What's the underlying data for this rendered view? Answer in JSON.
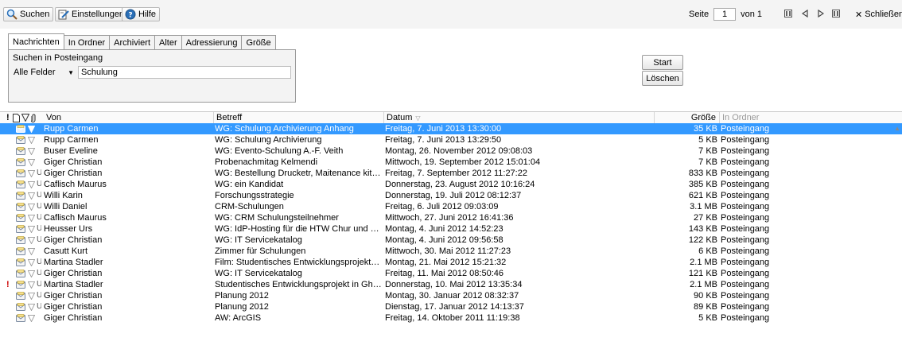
{
  "toolbar": {
    "search_label": "Suchen",
    "settings_label": "Einstellungen",
    "help_label": "Hilfe",
    "page_label": "Seite",
    "page_value": "1",
    "of_label": "von 1",
    "close_label": "Schließen"
  },
  "tabs": [
    "Nachrichten",
    "In Ordner",
    "Archiviert",
    "Alter",
    "Adressierung",
    "Größe"
  ],
  "search": {
    "panel_label": "Suchen in Posteingang",
    "field_select": "Alle Felder",
    "query": "Schulung",
    "start_label": "Start",
    "clear_label": "Löschen"
  },
  "columns": {
    "prio": "!",
    "von": "Von",
    "betreff": "Betreff",
    "datum": "Datum",
    "groesse": "Größe",
    "ordner": "In Ordner"
  },
  "colors": {
    "selection": "#3399ff",
    "priority": "#cc0000",
    "toolbar_bg": "#f4f4f4"
  },
  "messages": [
    {
      "prio": "",
      "att": "",
      "von": "Rupp Carmen",
      "betreff": "WG: Schulung Archivierung Anhang",
      "datum": "Freitag, 7. Juni 2013 13:30:00",
      "groesse": "35 KB",
      "ordner": "Posteingang",
      "selected": true
    },
    {
      "prio": "",
      "att": "",
      "von": "Rupp Carmen",
      "betreff": "WG: Schulung Archivierung",
      "datum": "Freitag, 7. Juni 2013 13:29:50",
      "groesse": "5 KB",
      "ordner": "Posteingang"
    },
    {
      "prio": "",
      "att": "",
      "von": "Buser Eveline",
      "betreff": "WG: Evento-Schulung A.-F. Veith",
      "datum": "Montag, 26. November 2012 09:08:03",
      "groesse": "7 KB",
      "ordner": "Posteingang"
    },
    {
      "prio": "",
      "att": "",
      "von": "Giger Christian",
      "betreff": "Probenachmitag Kelmendi",
      "datum": "Mittwoch, 19. September 2012 15:01:04",
      "groesse": "7 KB",
      "ordner": "Posteingang"
    },
    {
      "prio": "",
      "att": "U",
      "von": "Giger Christian",
      "betreff": "WG: Bestellung Drucketr, Maitenance kit und A...",
      "datum": "Freitag, 7. September 2012 11:27:22",
      "groesse": "833 KB",
      "ordner": "Posteingang"
    },
    {
      "prio": "",
      "att": "U",
      "von": "Caflisch Maurus",
      "betreff": "WG: ein Kandidat",
      "datum": "Donnerstag, 23. August 2012 10:16:24",
      "groesse": "385 KB",
      "ordner": "Posteingang"
    },
    {
      "prio": "",
      "att": "U",
      "von": "Willi Karin",
      "betreff": "Forschungsstrategie",
      "datum": "Donnerstag, 19. Juli 2012 08:12:37",
      "groesse": "621 KB",
      "ordner": "Posteingang"
    },
    {
      "prio": "",
      "att": "U",
      "von": "Willi Daniel",
      "betreff": "CRM-Schulungen",
      "datum": "Freitag, 6. Juli 2012 09:03:09",
      "groesse": "3.1 MB",
      "ordner": "Posteingang"
    },
    {
      "prio": "",
      "att": "U",
      "von": "Caflisch Maurus",
      "betreff": "WG: CRM Schulungsteilnehmer",
      "datum": "Mittwoch, 27. Juni 2012 16:41:36",
      "groesse": "27 KB",
      "ordner": "Posteingang"
    },
    {
      "prio": "",
      "att": "U",
      "von": "Heusser Urs",
      "betreff": "WG: IdP-Hosting für die HTW Chur und die PH...",
      "datum": "Montag, 4. Juni 2012 14:52:23",
      "groesse": "143 KB",
      "ordner": "Posteingang"
    },
    {
      "prio": "",
      "att": "U",
      "von": "Giger Christian",
      "betreff": "WG: IT Servicekatalog",
      "datum": "Montag, 4. Juni 2012 09:56:58",
      "groesse": "122 KB",
      "ordner": "Posteingang"
    },
    {
      "prio": "",
      "att": "",
      "von": "Casutt Kurt",
      "betreff": "Zimmer für Schulungen",
      "datum": "Mittwoch, 30. Mai 2012 11:27:23",
      "groesse": "6 KB",
      "ordner": "Posteingang"
    },
    {
      "prio": "",
      "att": "U",
      "von": "Martina Stadler",
      "betreff": "Film: Studentisches Entwicklungsprojekt in Gha...",
      "datum": "Montag, 21. Mai 2012 15:21:32",
      "groesse": "2.1 MB",
      "ordner": "Posteingang"
    },
    {
      "prio": "",
      "att": "U",
      "von": "Giger Christian",
      "betreff": "WG: IT Servicekatalog",
      "datum": "Freitag, 11. Mai 2012 08:50:46",
      "groesse": "121 KB",
      "ordner": "Posteingang"
    },
    {
      "prio": "!",
      "att": "U",
      "von": "Martina Stadler",
      "betreff": "Studentisches Entwicklungsprojekt in Ghana",
      "datum": "Donnerstag, 10. Mai 2012 13:35:34",
      "groesse": "2.1 MB",
      "ordner": "Posteingang"
    },
    {
      "prio": "",
      "att": "U",
      "von": "Giger Christian",
      "betreff": "Planung 2012",
      "datum": "Montag, 30. Januar 2012 08:32:37",
      "groesse": "90 KB",
      "ordner": "Posteingang"
    },
    {
      "prio": "",
      "att": "U",
      "von": "Giger Christian",
      "betreff": "Planung 2012",
      "datum": "Dienstag, 17. Januar 2012 14:13:37",
      "groesse": "89 KB",
      "ordner": "Posteingang"
    },
    {
      "prio": "",
      "att": "",
      "von": "Giger Christian",
      "betreff": "AW: ArcGIS",
      "datum": "Freitag, 14. Oktober 2011 11:19:38",
      "groesse": "5 KB",
      "ordner": "Posteingang"
    }
  ]
}
